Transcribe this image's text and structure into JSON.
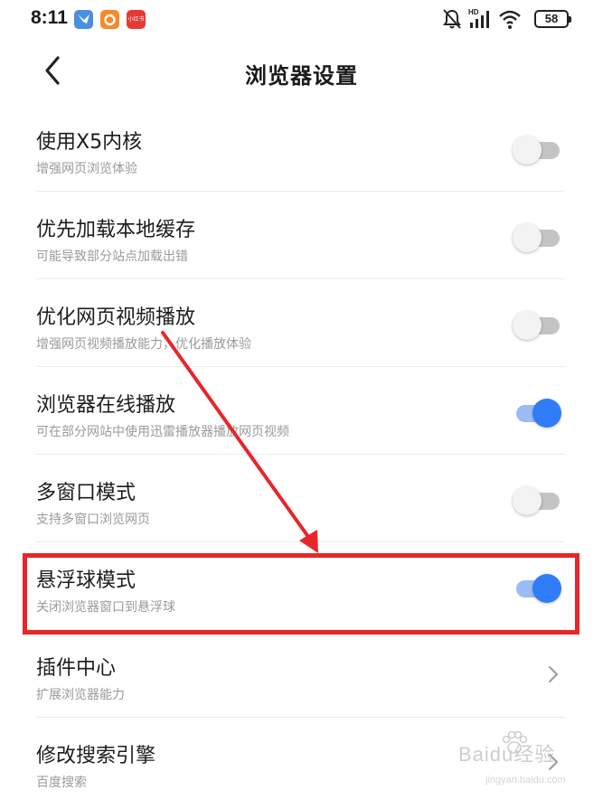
{
  "status_bar": {
    "time": "8:11",
    "app_icons": [
      "bird-app-icon",
      "orange-app-icon",
      "xiaohongshu-app-icon"
    ],
    "app_icon_3_text": "小红书",
    "network_label": "HD",
    "battery": "58"
  },
  "header": {
    "title": "浏览器设置",
    "back_icon": "chevron-left-icon"
  },
  "settings": [
    {
      "title": "使用X5内核",
      "subtitle": "增强网页浏览体验",
      "control": "toggle",
      "on": false
    },
    {
      "title": "优先加载本地缓存",
      "subtitle": "可能导致部分站点加载出错",
      "control": "toggle",
      "on": false
    },
    {
      "title": "优化网页视频播放",
      "subtitle": "增强网页视频播放能力，优化播放体验",
      "control": "toggle",
      "on": false
    },
    {
      "title": "浏览器在线播放",
      "subtitle": "可在部分网站中使用迅雷播放器播放网页视频",
      "control": "toggle",
      "on": true
    },
    {
      "title": "多窗口模式",
      "subtitle": "支持多窗口浏览网页",
      "control": "toggle",
      "on": false
    },
    {
      "title": "悬浮球模式",
      "subtitle": "关闭浏览器窗口到悬浮球",
      "control": "toggle",
      "on": true
    },
    {
      "title": "插件中心",
      "subtitle": "扩展浏览器能力",
      "control": "chevron"
    },
    {
      "title": "修改搜索引擎",
      "subtitle": "百度搜索",
      "control": "chevron"
    }
  ],
  "colors": {
    "toggle_on": "#2f7cf6",
    "toggle_on_track": "#9bbcf4",
    "toggle_off_track": "#c4c4c4",
    "annotation": "#e6262b"
  },
  "watermark": {
    "text": "Baidu经验",
    "url": "jingyan.baidu.com"
  }
}
